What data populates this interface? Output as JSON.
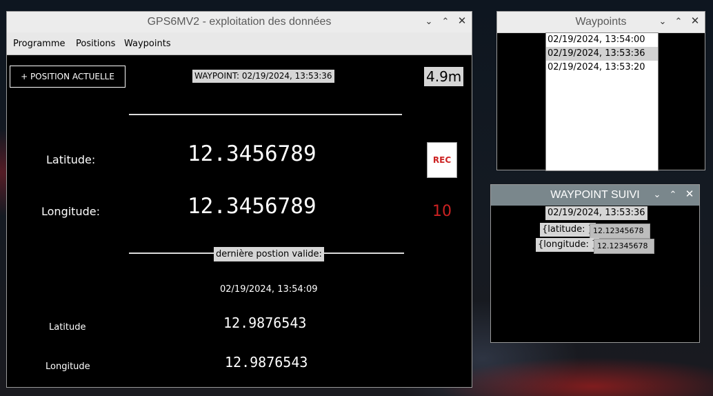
{
  "main_window": {
    "title": "GPS6MV2 - exploitation des données",
    "menu": [
      "Programme",
      "Positions",
      "Waypoints"
    ],
    "add_position_button": "+ POSITION ACTUELLE",
    "waypoint_label": "WAYPOINT: 02/19/2024, 13:53:36",
    "accuracy": "4.9m",
    "latitude_label": "Latitude:",
    "latitude_value": "12.3456789",
    "longitude_label": "Longitude:",
    "longitude_value": "12.3456789",
    "rec_button": "REC",
    "satellite_count": "10",
    "last_valid_label": "dernière postion valide:",
    "last_valid_time": "02/19/2024, 13:54:09",
    "last_latitude_label": "Latitude",
    "last_latitude_value": "12.9876543",
    "last_longitude_label": "Longitude",
    "last_longitude_value": "12.9876543"
  },
  "waypoints_window": {
    "title": "Waypoints",
    "items": [
      "02/19/2024, 13:54:00",
      "02/19/2024, 13:53:36",
      "02/19/2024, 13:53:20"
    ],
    "selected_index": 1
  },
  "followed_window": {
    "title": "WAYPOINT SUIVI",
    "time": "02/19/2024, 13:53:36",
    "latitude_label": "{latitude: }",
    "latitude_value": "12.12345678",
    "longitude_label": "{longitude: }",
    "longitude_value": "12.12345678"
  },
  "colors": {
    "accent_red": "#cc2222",
    "titlebar_light": "#ececec",
    "titlebar_dark": "#7a878c"
  },
  "icons": [
    "chevron-down-icon",
    "chevron-up-icon",
    "close-icon"
  ]
}
